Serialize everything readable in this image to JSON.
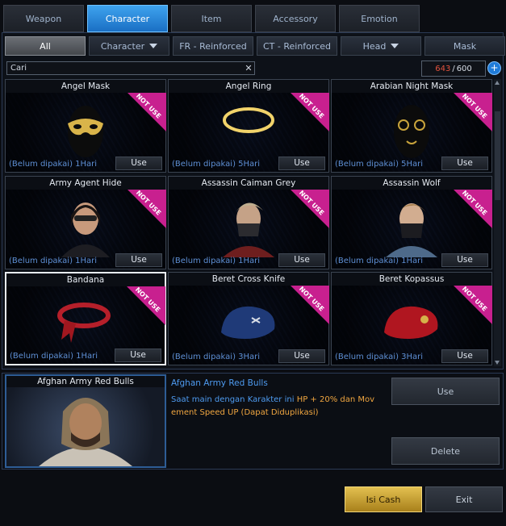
{
  "top_tabs": [
    "Weapon",
    "Character",
    "Item",
    "Accessory",
    "Emotion"
  ],
  "sub_tabs": {
    "all": "All",
    "character": "Character",
    "fr": "FR - Reinforced",
    "ct": "CT - Reinforced",
    "head": "Head",
    "mask": "Mask"
  },
  "search": {
    "value": "Cari"
  },
  "inventory": {
    "used": "643",
    "sep": "/",
    "max": "600",
    "add": "+"
  },
  "items": [
    {
      "name": "Angel Mask",
      "status": "(Belum dipakai) 1Hari",
      "button": "Use",
      "badge": "NOT USE"
    },
    {
      "name": "Angel Ring",
      "status": "(Belum dipakai) 5Hari",
      "button": "Use",
      "badge": "NOT USE"
    },
    {
      "name": "Arabian Night Mask",
      "status": "(Belum dipakai) 5Hari",
      "button": "Use",
      "badge": "NOT USE"
    },
    {
      "name": "Army Agent Hide",
      "status": "(Belum dipakai) 1Hari",
      "button": "Use",
      "badge": "NOT USE"
    },
    {
      "name": "Assassin Caiman Grey",
      "status": "(Belum dipakai) 1Hari",
      "button": "Use",
      "badge": "NOT USE"
    },
    {
      "name": "Assassin Wolf",
      "status": "(Belum dipakai) 1Hari",
      "button": "Use",
      "badge": "NOT USE"
    },
    {
      "name": "Bandana",
      "status": "(Belum dipakai) 1Hari",
      "button": "Use",
      "badge": "NOT USE"
    },
    {
      "name": "Beret Cross Knife",
      "status": "(Belum dipakai) 3Hari",
      "button": "Use",
      "badge": "NOT USE"
    },
    {
      "name": "Beret Kopassus",
      "status": "(Belum dipakai) 3Hari",
      "button": "Use",
      "badge": "NOT USE"
    }
  ],
  "detail": {
    "preview_name": "Afghan Army Red Bulls",
    "title": "Afghan Army Red Bulls",
    "desc_part1": "Saat main dengan Karakter ini ",
    "desc_highlight": "HP + 20% dan Mov ement Speed UP (Dapat Diduplikasi)",
    "use_label": "Use",
    "delete_label": "Delete"
  },
  "footer": {
    "cash_label": "Isi Cash",
    "exit_label": "Exit"
  },
  "colors": {
    "accent": "#1a6fc4",
    "badge": "#c8208f",
    "status_text": "#5e8fd4",
    "count_over": "#e0523d",
    "cash": "#e3c050"
  }
}
